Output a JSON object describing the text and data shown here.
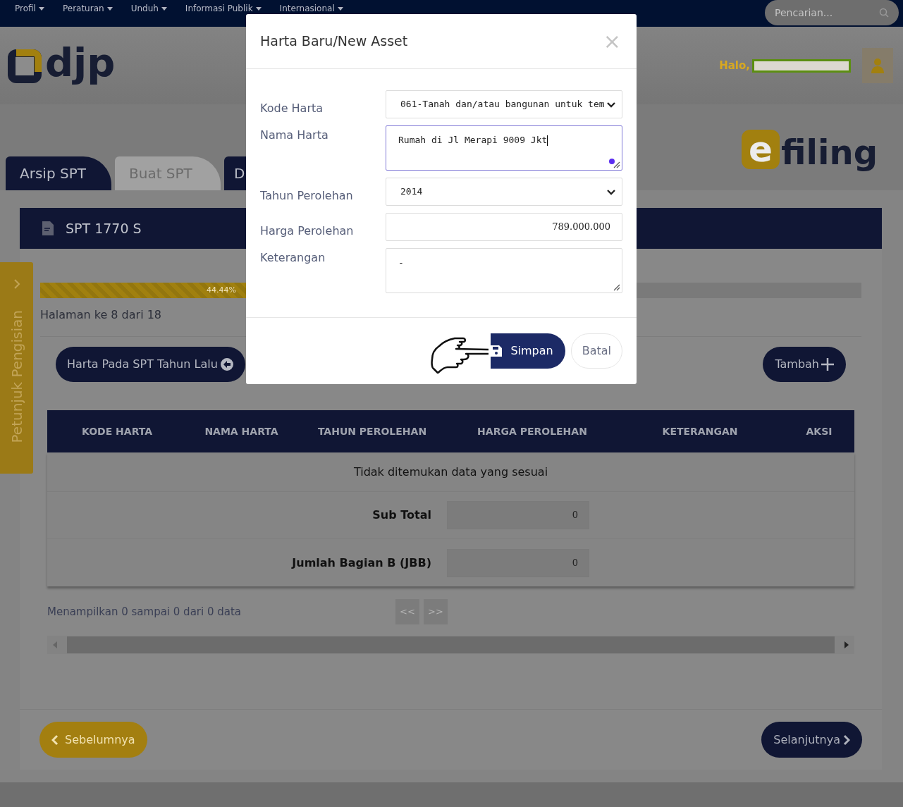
{
  "nav": {
    "items": [
      "Profil",
      "Peraturan",
      "Unduh",
      "Informasi Publik",
      "Internasional"
    ],
    "search": {
      "placeholder": "Pencarian..."
    }
  },
  "header": {
    "logo": "djp",
    "greeting": "Halo,"
  },
  "banner": {
    "logo_prefix": "e",
    "logo_text": "filing"
  },
  "tabs": [
    {
      "label": "Arsip SPT",
      "selected": false
    },
    {
      "label": "Buat SPT",
      "selected": true
    },
    {
      "label": "D",
      "selected": false
    }
  ],
  "side_tab": {
    "label": "Petunjuk Pengisian"
  },
  "form_card": {
    "title": "SPT 1770 S",
    "progress": {
      "level": 0.4444,
      "label": "44.44%"
    },
    "page_info": "Halaman ke 8 dari 18",
    "previous_year_button": "Harta Pada SPT Tahun Lalu",
    "add_button": "Tambah",
    "table": {
      "columns": [
        "KODE HARTA",
        "NAMA HARTA",
        "TAHUN PEROLEHAN",
        "HARGA PEROLEHAN",
        "KETERANGAN",
        "AKSI"
      ],
      "empty_message": "Tidak ditemukan data yang sesuai",
      "totals": [
        {
          "label": "Sub Total",
          "value": "0"
        },
        {
          "label": "Jumlah Bagian B (JBB)",
          "value": "0"
        }
      ]
    },
    "pagination": {
      "info": "Menampilkan 0 sampai 0 dari 0 data",
      "prev": "<<",
      "next": ">>"
    },
    "back_button": "Sebelumnya",
    "next_button": "Selanjutnya"
  },
  "modal": {
    "title": "Harta Baru/New Asset",
    "close": "×",
    "fields": [
      {
        "kind": "select",
        "label": "Kode Harta",
        "value": "061-Tanah dan/atau bangunan untuk tem"
      },
      {
        "kind": "textarea",
        "label": "Nama Harta",
        "value": "Rumah di Jl Merapi 9009 Jkt",
        "focused": true
      },
      {
        "kind": "select",
        "label": "Tahun Perolehan",
        "value": "2014"
      },
      {
        "kind": "number",
        "label": "Harga Perolehan",
        "value": "789.000.000"
      },
      {
        "kind": "textarea",
        "label": "Keterangan",
        "value": "-",
        "focused": false
      }
    ],
    "save_button": "Simpan",
    "cancel_button": "Batal"
  }
}
